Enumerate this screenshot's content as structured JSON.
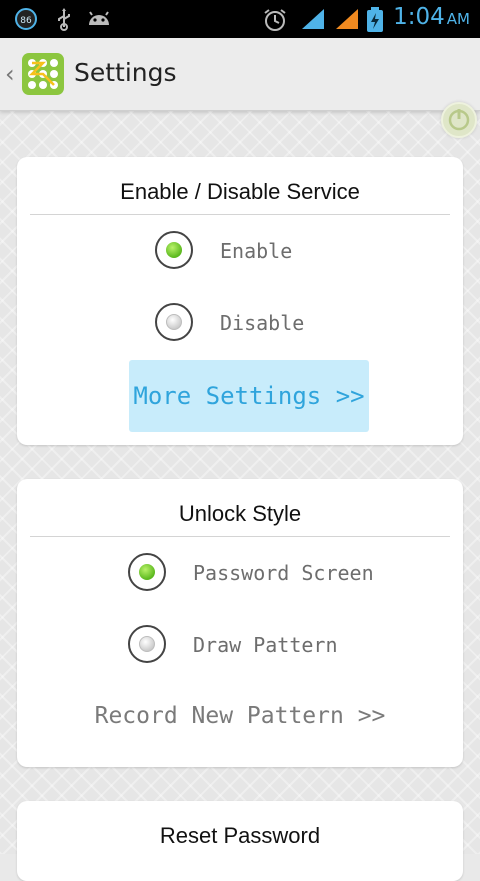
{
  "status_bar": {
    "badge": "86",
    "time": "1:04",
    "ampm": "AM",
    "icons": [
      "usb-icon",
      "android-icon",
      "alarm-icon",
      "wifi-signal-icon",
      "cell-signal-icon",
      "battery-charging-icon"
    ]
  },
  "action_bar": {
    "title": "Settings"
  },
  "service_card": {
    "title": "Enable / Disable Service",
    "options": [
      {
        "label": "Enable",
        "selected": true
      },
      {
        "label": "Disable",
        "selected": false
      }
    ],
    "more_button": "More Settings >>"
  },
  "unlock_card": {
    "title": "Unlock Style",
    "options": [
      {
        "label": "Password Screen",
        "selected": true
      },
      {
        "label": "Draw Pattern",
        "selected": false
      }
    ],
    "record_link": "Record New Pattern >>"
  },
  "reset_card": {
    "title": "Reset Password"
  },
  "colors": {
    "accent": "#2fa4dc",
    "button_bg": "#c8ecfb",
    "radio_on": "#5bb81e",
    "status_icons": "#4fb3e8"
  }
}
